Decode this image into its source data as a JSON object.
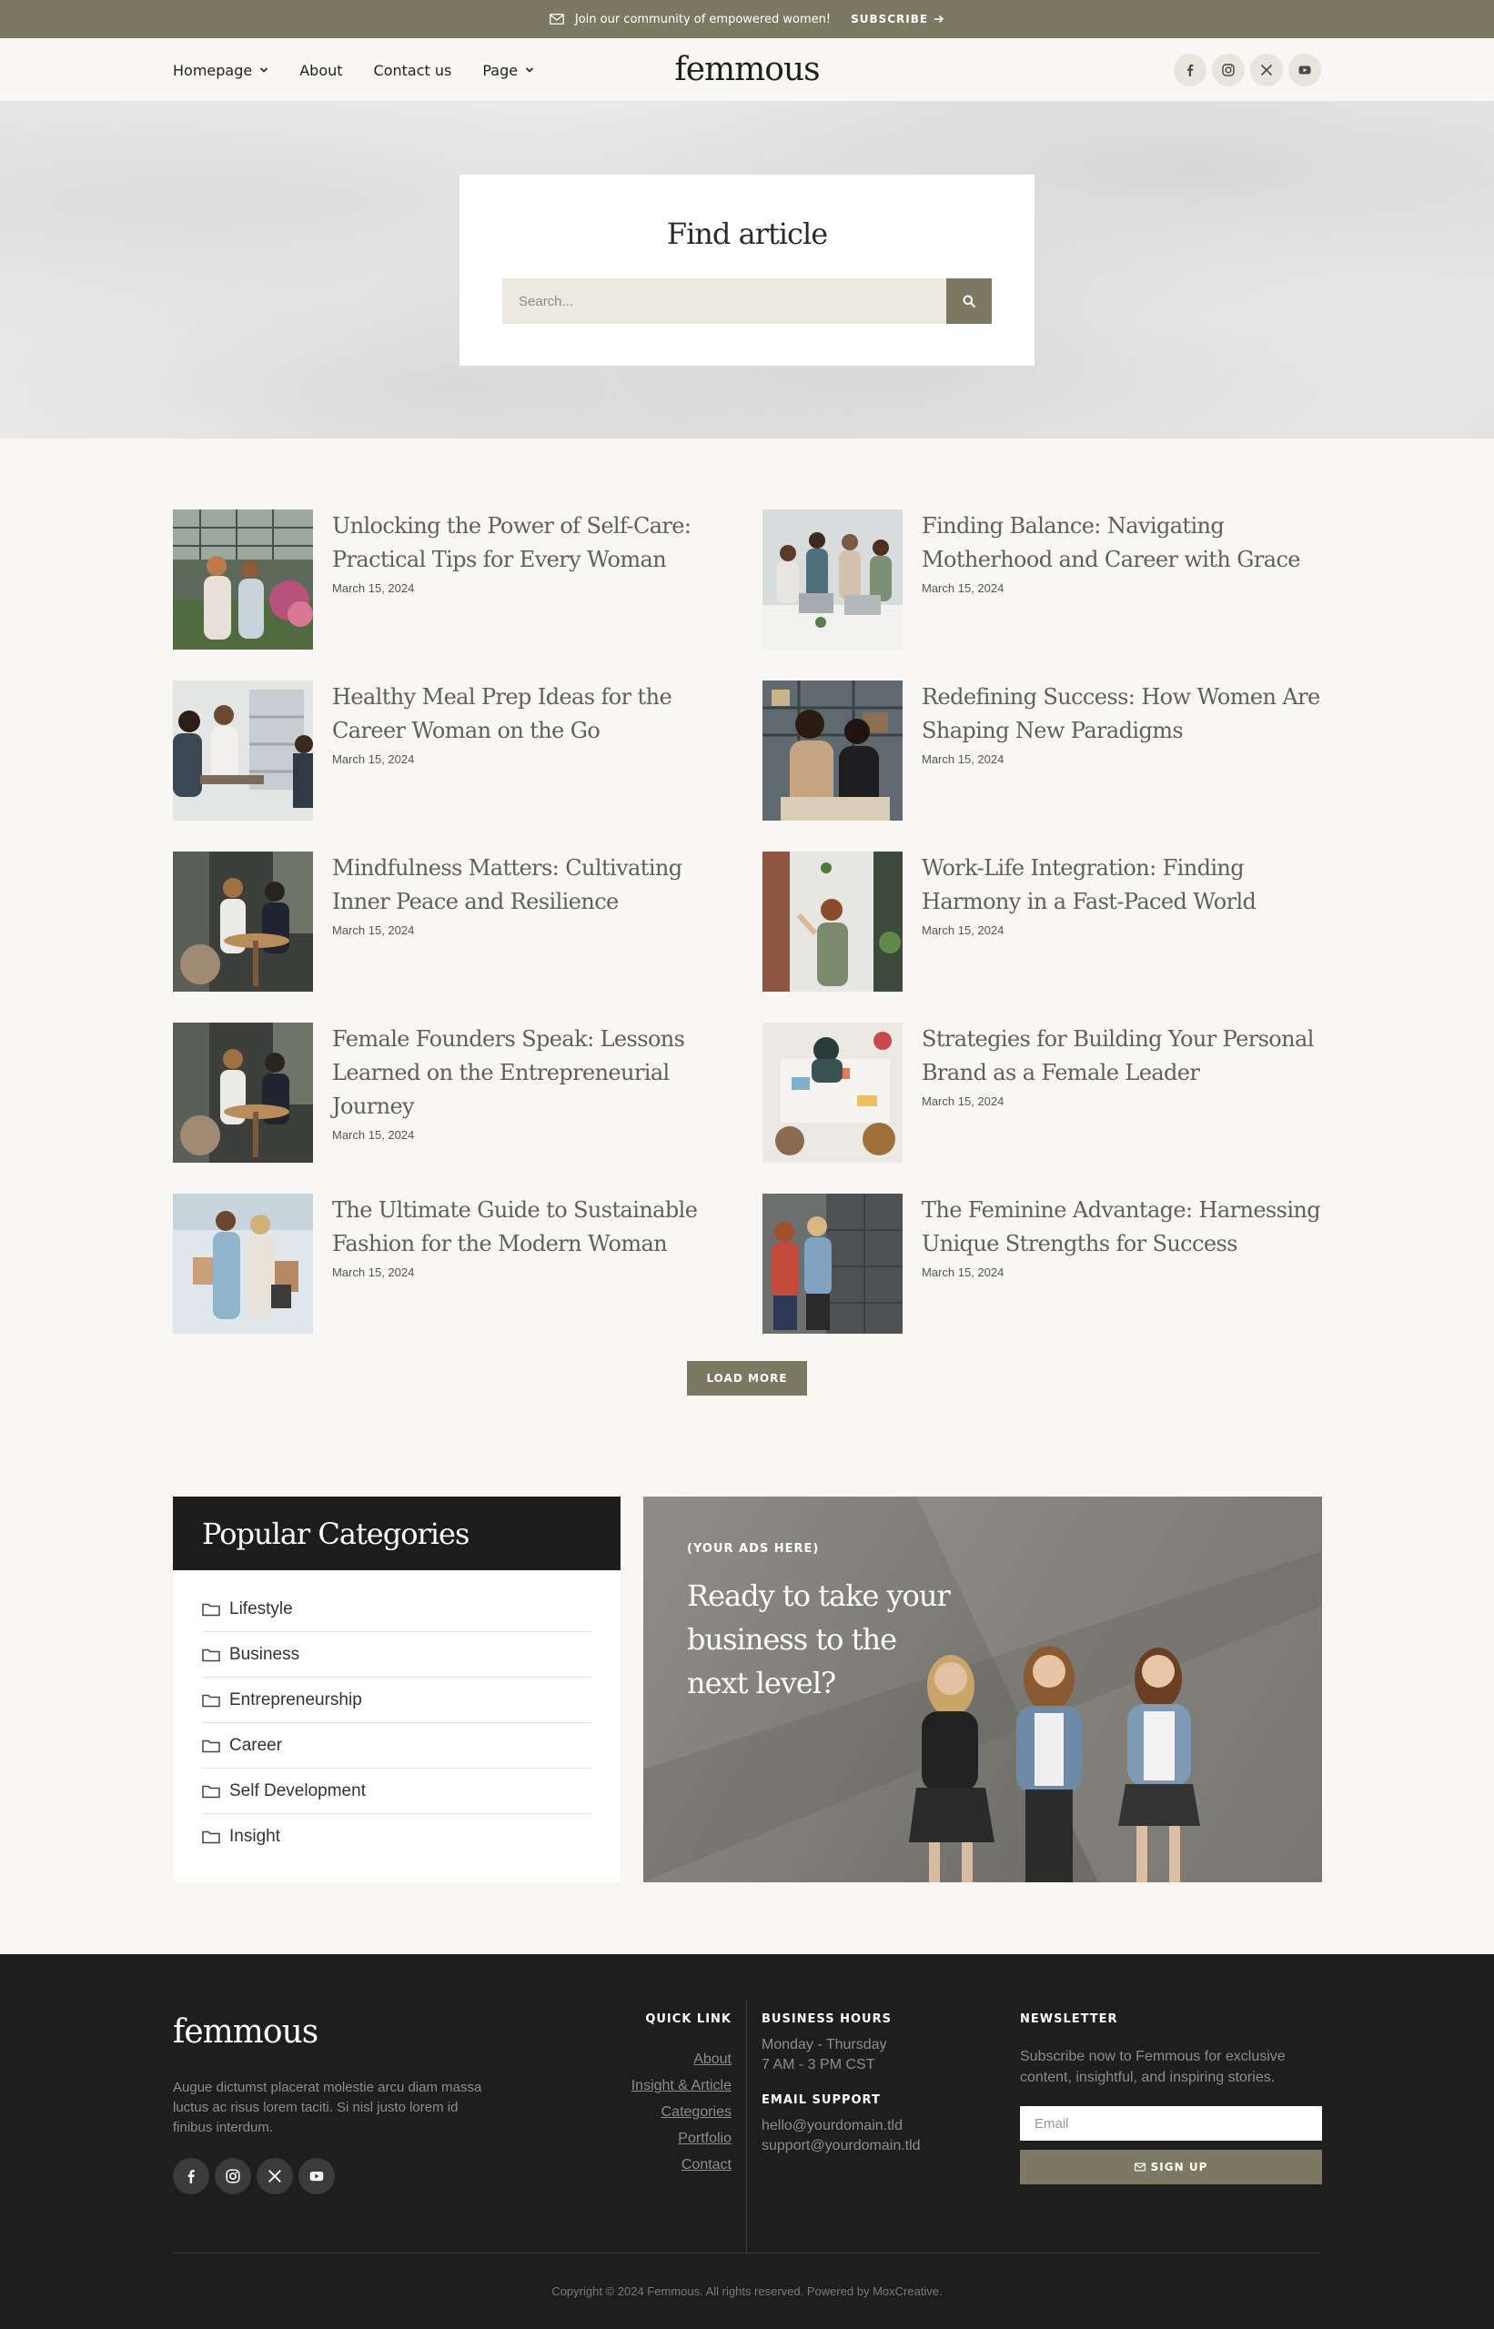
{
  "topbar": {
    "message": "Join our community of empowered women!",
    "subscribe_label": "SUBSCRIBE"
  },
  "header": {
    "logo": "femmous",
    "nav": [
      {
        "label": "Homepage",
        "dropdown": true
      },
      {
        "label": "About",
        "dropdown": false
      },
      {
        "label": "Contact us",
        "dropdown": false
      },
      {
        "label": "Page",
        "dropdown": true
      }
    ],
    "socials": [
      "facebook-icon",
      "instagram-icon",
      "x-icon",
      "youtube-icon"
    ]
  },
  "search": {
    "title": "Find article",
    "placeholder": "Search..."
  },
  "articles": [
    {
      "title": "Unlocking the Power of Self-Care: Practical Tips for Every Woman",
      "date": "March 15, 2024"
    },
    {
      "title": "Finding Balance: Navigating Motherhood and Career with Grace",
      "date": "March 15, 2024"
    },
    {
      "title": "Healthy Meal Prep Ideas for the Career Woman on the Go",
      "date": "March 15, 2024"
    },
    {
      "title": "Redefining Success: How Women Are Shaping New Paradigms",
      "date": "March 15, 2024"
    },
    {
      "title": "Mindfulness Matters: Cultivating Inner Peace and Resilience",
      "date": "March 15, 2024"
    },
    {
      "title": "Work-Life Integration: Finding Harmony in a Fast-Paced World",
      "date": "March 15, 2024"
    },
    {
      "title": "Female Founders Speak: Lessons Learned on the Entrepreneurial Journey",
      "date": "March 15, 2024"
    },
    {
      "title": "Strategies for Building Your Personal Brand as a Female Leader",
      "date": "March 15, 2024"
    },
    {
      "title": "The Ultimate Guide to Sustainable Fashion for the Modern Woman",
      "date": "March 15, 2024"
    },
    {
      "title": "The Feminine Advantage: Harnessing Unique Strengths for Success",
      "date": "March 15, 2024"
    }
  ],
  "load_more_label": "LOAD MORE",
  "categories": {
    "title": "Popular Categories",
    "items": [
      "Lifestyle",
      "Business",
      "Entrepreneurship",
      "Career",
      "Self Development",
      "Insight"
    ]
  },
  "ad": {
    "tag": "(YOUR ADS HERE)",
    "headline": "Ready to take your business to the next level?"
  },
  "footer": {
    "logo": "femmous",
    "about": "Augue dictumst placerat molestie arcu diam massa luctus ac risus lorem taciti. Si nisl justo lorem id finibus interdum.",
    "quick_link": {
      "heading": "QUICK LINK",
      "links": [
        "About",
        "Insight & Article",
        "Categories",
        "Portfolio",
        "Contact"
      ]
    },
    "business_hours": {
      "heading": "BUSINESS HOURS",
      "days": "Monday - Thursday",
      "time": "7 AM - 3 PM CST"
    },
    "email_support": {
      "heading": "EMAIL SUPPORT",
      "email1": "hello@yourdomain.tld",
      "email2": "support@yourdomain.tld"
    },
    "newsletter": {
      "heading": "NEWSLETTER",
      "text": "Subscribe now to Femmous for exclusive content, insightful, and inspiring stories.",
      "email_placeholder": "Email",
      "signup_label": "SIGN UP"
    },
    "copyright": "Copyright © 2024 Femmous. All rights reserved. Powered by MoxCreative."
  },
  "colors": {
    "accent": "#7b7962",
    "dark": "#1e1e1e",
    "background": "#f9f7f4"
  }
}
